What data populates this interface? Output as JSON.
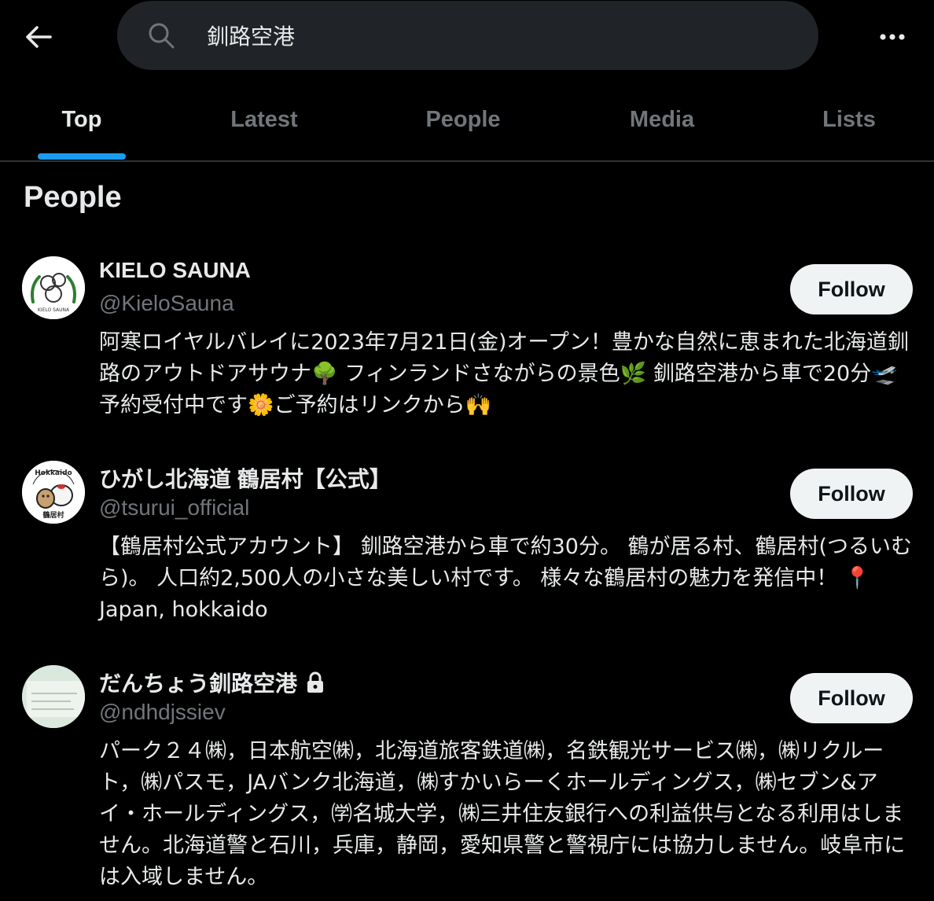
{
  "search": {
    "query": "釧路空港"
  },
  "tabs": [
    {
      "label": "Top"
    },
    {
      "label": "Latest"
    },
    {
      "label": "People"
    },
    {
      "label": "Media"
    },
    {
      "label": "Lists"
    }
  ],
  "section": {
    "title": "People"
  },
  "users": [
    {
      "name": "KIELO SAUNA",
      "handle": "@KieloSauna",
      "follow_label": "Follow",
      "bio": "阿寒ロイヤルバレイに2023年7月21日(金)オープン！豊かな自然に恵まれた北海道釧路のアウトドアサウナ🌳 フィンランドさながらの景色🌿 釧路空港から車で20分🛫 予約受付中です🌼ご予約はリンクから🙌"
    },
    {
      "name": "ひがし北海道 鶴居村【公式】",
      "handle": "@tsurui_official",
      "follow_label": "Follow",
      "bio": "【鶴居村公式アカウント】 釧路空港から車で約30分。 鶴が居る村、鶴居村(つるいむら)。 人口約2,500人の小さな美しい村です。 様々な鶴居村の魅力を発信中！ 📍Japan, hokkaido"
    },
    {
      "name": "だんちょう釧路空港",
      "handle": "@ndhdjssiev",
      "follow_label": "Follow",
      "bio": "パーク２４㈱，日本航空㈱，北海道旅客鉄道㈱，名鉄観光サービス㈱，㈱リクルート，㈱パスモ，JAバンク北海道，㈱すかいらーくホールディングス，㈱セブン&アイ・ホールディングス，㈻名城大学，㈱三井住友銀行への利益供与となる利用はしません。北海道警と石川，兵庫，静岡，愛知県警と警視庁には協力しません。岐阜市には入域しません。"
    }
  ]
}
